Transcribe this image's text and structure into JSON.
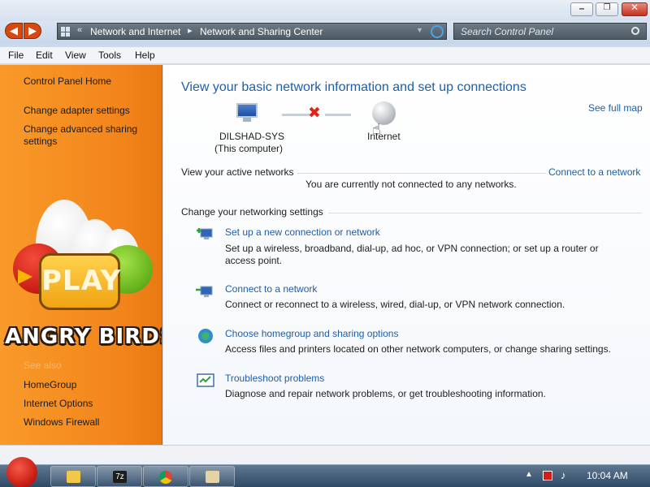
{
  "window": {
    "minimize_icon": "minimize-icon",
    "maximize_icon": "restore-icon",
    "close_icon": "close-icon"
  },
  "address_bar": {
    "chevron": "«",
    "crumbs": [
      "Network and Internet",
      "Network and Sharing Center"
    ],
    "separator": "▸"
  },
  "search": {
    "placeholder": "Search Control Panel"
  },
  "menu": [
    "File",
    "Edit",
    "View",
    "Tools",
    "Help"
  ],
  "sidebar": {
    "home": "Control Panel Home",
    "links": [
      "Change adapter settings",
      "Change advanced sharing settings"
    ],
    "see_also_label": "See also",
    "see_also": [
      "HomeGroup",
      "Internet Options",
      "Windows Firewall"
    ],
    "art": {
      "play": "PLAY",
      "logo": "ANGRY BIRDS"
    }
  },
  "main": {
    "heading": "View your basic network information and set up connections",
    "see_full_map": "See full map",
    "computer_name": "DILSHAD-SYS",
    "computer_caption": "(This computer)",
    "internet_label": "Internet",
    "active_networks_label": "View your active networks",
    "not_connected": "You are currently not connected to any networks.",
    "connect_link": "Connect to a network",
    "change_settings_label": "Change your networking settings",
    "tasks": [
      {
        "title": "Set up a new connection or network",
        "desc": "Set up a wireless, broadband, dial-up, ad hoc, or VPN connection; or set up a router or access point.",
        "icon": "new-connection-icon"
      },
      {
        "title": "Connect to a network",
        "desc": "Connect or reconnect to a wireless, wired, dial-up, or VPN network connection.",
        "icon": "connect-network-icon"
      },
      {
        "title": "Choose homegroup and sharing options",
        "desc": "Access files and printers located on other network computers, or change sharing settings.",
        "icon": "homegroup-icon"
      },
      {
        "title": "Troubleshoot problems",
        "desc": "Diagnose and repair network problems, or get troubleshooting information.",
        "icon": "troubleshoot-icon"
      }
    ]
  },
  "taskbar": {
    "apps": [
      "explorer-icon",
      "7zip-icon",
      "chrome-icon",
      "paint-icon"
    ],
    "app_7zip_text": "7z",
    "clock": "10:04 AM"
  }
}
